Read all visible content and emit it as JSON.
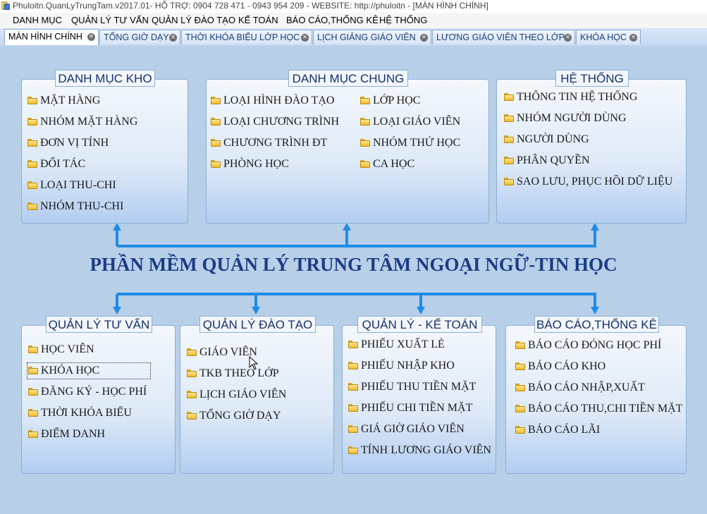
{
  "window": {
    "title": "Phuloitn.QuanLyTrungTam.v2017.01- HỖ TRỢ: 0904 728 471 - 0943 954 209 - WEBSITE: http://phuloitn - [MÀN HÌNH CHÍNH]"
  },
  "menu": [
    "DANH MỤC",
    "QUẢN LÝ TƯ VẤN",
    "QUẢN LÝ ĐÀO TẠO",
    "KẾ TOÁN",
    "BÁO CÁO,THỐNG KÊ",
    "HỆ THỐNG"
  ],
  "tabs": [
    {
      "label": "MÀN HÌNH CHÍNH",
      "active": true
    },
    {
      "label": "TỔNG GIỜ DẠY",
      "active": false
    },
    {
      "label": "THỜI KHÓA BIỂU LỚP HỌC",
      "active": false
    },
    {
      "label": "LỊCH GIẢNG GIÁO VIÊN",
      "active": false
    },
    {
      "label": "LƯƠNG GIÁO VIÊN THEO LỚP",
      "active": false
    },
    {
      "label": "KHÓA HỌC",
      "active": false
    }
  ],
  "main_title": "PHẦN MỀM QUẢN LÝ TRUNG TÂM NGOẠI NGỮ-TIN HỌC",
  "panels": {
    "danh_muc_kho": {
      "title": "DANH MỤC KHO",
      "items": [
        "MẶT HÀNG",
        "NHÓM MẶT HÀNG",
        "ĐƠN VỊ TÍNH",
        "ĐỐI TÁC",
        "LOẠI THU-CHI",
        "NHÓM THU-CHI"
      ]
    },
    "danh_muc_chung": {
      "title": "DANH MỤC CHUNG",
      "items_left": [
        "LOẠI HÌNH ĐÀO TẠO",
        "LOẠI CHƯƠNG TRÌNH",
        "CHƯƠNG TRÌNH ĐT",
        "PHÒNG HỌC"
      ],
      "items_right": [
        "LỚP HỌC",
        "LOẠI GIÁO VIÊN",
        "NHÓM THỨ HỌC",
        "CA HỌC"
      ]
    },
    "he_thong": {
      "title": "HỆ THỐNG",
      "items": [
        "THÔNG TIN HỆ THỐNG",
        "NHÓM NGƯỜI DÙNG",
        "NGƯỜI DÙNG",
        "PHÂN QUYỀN",
        "SAO LƯU, PHỤC HỒI DỮ LIỆU"
      ]
    },
    "quan_ly_tu_van": {
      "title": "QUẢN LÝ TƯ VẤN",
      "items": [
        "HỌC VIÊN",
        "KHÓA HỌC",
        "ĐĂNG KÝ - HỌC PHÍ",
        "THỜI KHÓA BIỂU",
        "ĐIỂM DANH"
      ]
    },
    "quan_ly_dao_tao": {
      "title": "QUẢN LÝ ĐÀO TẠO",
      "items": [
        "GIÁO VIÊN",
        "TKB THEO LỚP",
        "LỊCH GIÁO VIÊN",
        "TỔNG GIỜ DẠY"
      ]
    },
    "quan_ly_ke_toan": {
      "title": "QUẢN LÝ - KẾ TOÁN",
      "items": [
        "PHIẾU XUẤT LẺ",
        "PHIẾU NHẬP KHO",
        "PHIẾU THU TIỀN MẶT",
        "PHIẾU CHI TIỀN MẶT",
        "GIÁ GIỜ GIÁO VIÊN",
        "TÍNH LƯƠNG GIÁO VIÊN"
      ]
    },
    "bao_cao_thong_ke": {
      "title": "BÁO CÁO,THỐNG KÊ",
      "items": [
        "BÁO CÁO ĐÓNG HỌC PHÍ",
        "BÁO CÁO KHO",
        "BÁO CÁO NHẬP,XUẤT",
        "BÁO CÁO THU,CHI TIỀN MẶT",
        "BÁO CÁO LÃI"
      ]
    }
  },
  "colors": {
    "background": "#b8cfe8",
    "connector": "#1e8ce6",
    "title": "#1c3c86",
    "panel_title": "#15306a"
  }
}
